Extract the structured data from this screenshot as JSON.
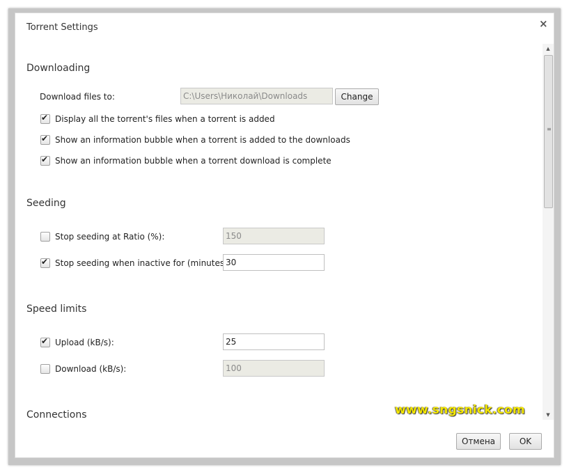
{
  "dialog": {
    "title": "Torrent Settings",
    "close_glyph": "×"
  },
  "downloading": {
    "heading": "Downloading",
    "download_to_label": "Download files to:",
    "download_path": "C:\\Users\\Николай\\Downloads",
    "change_label": "Change",
    "options": [
      {
        "label": "Display all the torrent's files when a torrent is added",
        "checked": true
      },
      {
        "label": "Show an information bubble when a torrent is added to the downloads",
        "checked": true
      },
      {
        "label": "Show an information bubble when a torrent download is complete",
        "checked": true
      }
    ]
  },
  "seeding": {
    "heading": "Seeding",
    "ratio": {
      "label": "Stop seeding at Ratio (%):",
      "checked": false,
      "value": "150"
    },
    "inactive": {
      "label": "Stop seeding when inactive for (minutes):",
      "checked": true,
      "value": "30"
    }
  },
  "speed_limits": {
    "heading": "Speed limits",
    "upload": {
      "label": "Upload (kB/s):",
      "checked": true,
      "value": "25"
    },
    "download": {
      "label": "Download (kB/s):",
      "checked": false,
      "value": "100"
    }
  },
  "connections": {
    "heading": "Connections"
  },
  "footer": {
    "cancel_label": "Отмена",
    "ok_label": "OK"
  },
  "watermark": {
    "text": "www.sngsnick.com",
    "color": "#f3e600"
  },
  "icons": {
    "checkmark": "✔",
    "scroll_up": "▲",
    "scroll_down": "▼",
    "grip": "≡"
  }
}
